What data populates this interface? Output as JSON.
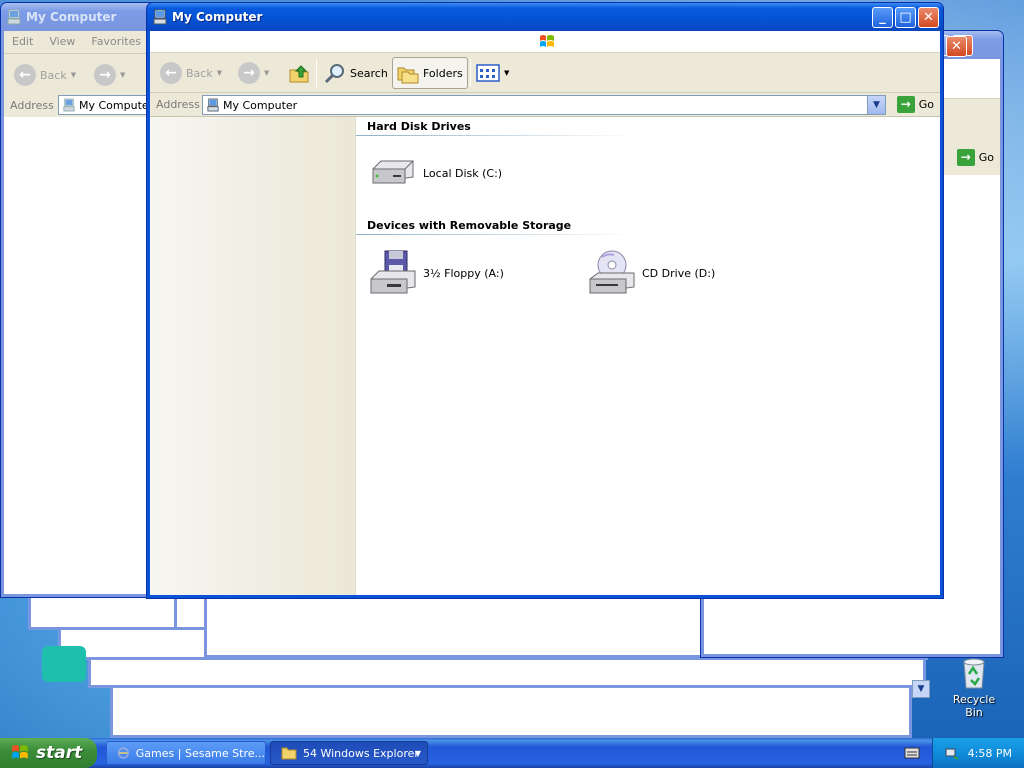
{
  "colors": {
    "titlebar_active": "#0552d4",
    "titlebar_inactive": "#7a96df",
    "taskbar": "#2663e0",
    "start_green": "#3c8e3a"
  },
  "bg_window_left": {
    "title": "My Computer",
    "menu": [
      "Edit",
      "View",
      "Favorites"
    ],
    "back_label": "Back",
    "address_label": "Address",
    "address_value": "My Computer"
  },
  "bg_window_right": {
    "go_label": "Go"
  },
  "main": {
    "title": "My Computer",
    "toolbar": {
      "back": "Back",
      "search": "Search",
      "folders": "Folders"
    },
    "address": {
      "label": "Address",
      "value": "My Computer",
      "go": "Go"
    },
    "groups": [
      {
        "heading": "Hard Disk Drives",
        "items": [
          {
            "label": "Local Disk (C:)",
            "icon": "hard-disk-icon"
          }
        ]
      },
      {
        "heading": "Devices with Removable Storage",
        "items": [
          {
            "label": "3½ Floppy (A:)",
            "icon": "floppy-drive-icon"
          },
          {
            "label": "CD Drive (D:)",
            "icon": "cd-drive-icon"
          }
        ]
      }
    ]
  },
  "desktop": {
    "recycle_bin": "Recycle Bin"
  },
  "taskbar": {
    "start": "start",
    "tasks": [
      {
        "label": "Games | Sesame Stre..."
      },
      {
        "label": "54 Windows Explorer"
      }
    ],
    "clock": "4:58 PM"
  }
}
